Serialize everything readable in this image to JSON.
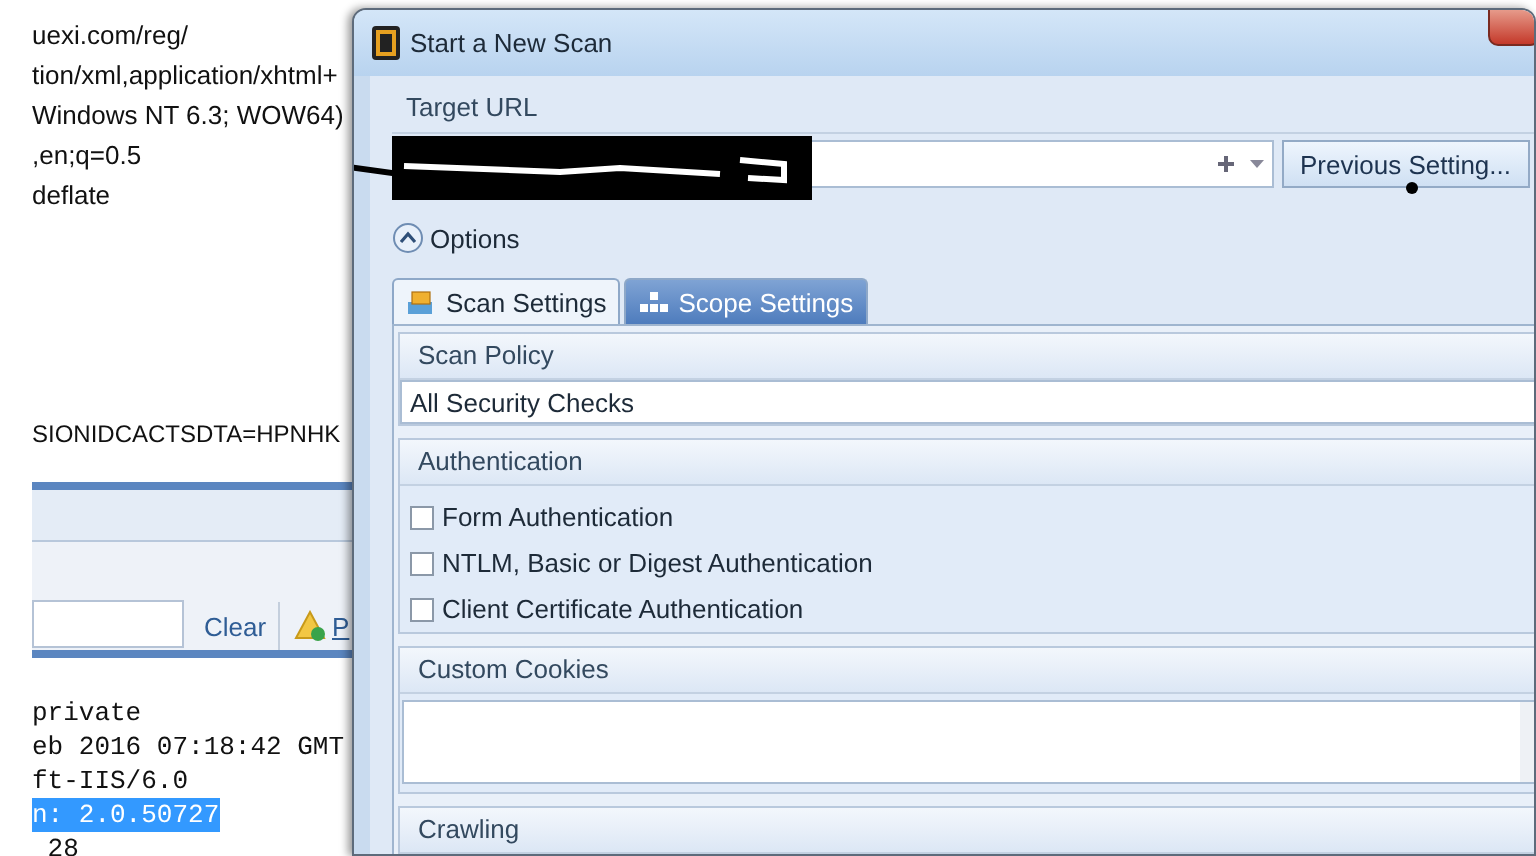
{
  "background_window": {
    "header_lines": [
      "uexi.com/reg/",
      "tion/xml,application/xhtml+",
      "Windows NT 6.3; WOW64)",
      ",en;q=0.5",
      "deflate"
    ],
    "cookie_line": "SIONIDCACTSDTA=HPNHK",
    "clear_button": "Clear",
    "next_button": "P",
    "response_lines": [
      {
        "text": "private",
        "selected": false
      },
      {
        "text": "eb 2016 07:18:42 GMT",
        "selected": false
      },
      {
        "text": "ft-IIS/6.0",
        "selected": false
      },
      {
        "text": "n: 2.0.50727",
        "selected": true
      },
      {
        "text": " 28",
        "selected": false
      }
    ]
  },
  "dialog": {
    "title": "Start a New Scan",
    "target_url": {
      "label": "Target URL",
      "previous_settings_button": "Previous Setting..."
    },
    "options": {
      "label": "Options",
      "expanded": true
    },
    "tabs": [
      {
        "label": "Scan Settings",
        "selected": true
      },
      {
        "label": "Scope Settings",
        "selected": false
      }
    ],
    "scan_policy": {
      "label": "Scan Policy",
      "value": "All Security Checks"
    },
    "authentication": {
      "label": "Authentication",
      "options": [
        {
          "label": "Form Authentication",
          "checked": false
        },
        {
          "label": "NTLM, Basic or Digest Authentication",
          "checked": false
        },
        {
          "label": "Client Certificate Authentication",
          "checked": false
        }
      ]
    },
    "custom_cookies": {
      "label": "Custom Cookies"
    },
    "crawling": {
      "label": "Crawling"
    }
  }
}
